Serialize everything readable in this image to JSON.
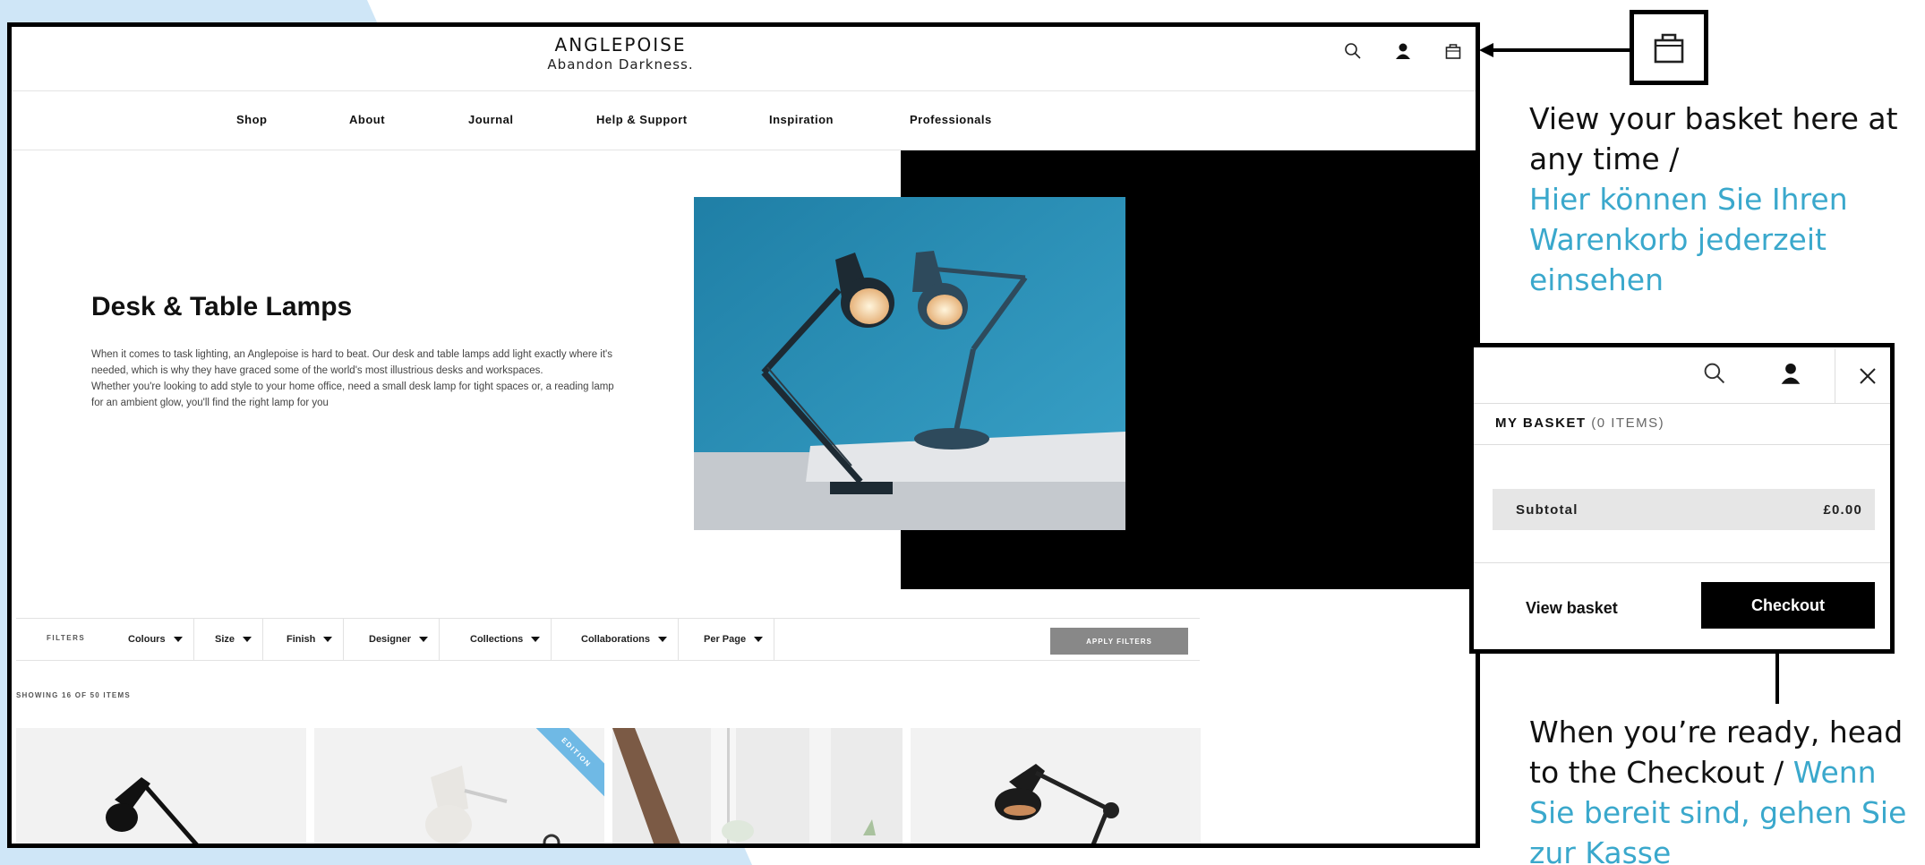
{
  "site": {
    "brand_name": "ANGLEPOISE",
    "brand_tagline": "Abandon Darkness.",
    "header_icons": [
      "search-icon",
      "account-icon",
      "basket-icon"
    ],
    "nav": [
      "Shop",
      "About",
      "Journal",
      "Help & Support",
      "Inspiration",
      "Professionals"
    ],
    "hero": {
      "title": "Desk & Table Lamps",
      "paragraph_1": "When it comes to task lighting, an Anglepoise is hard to beat. Our desk and table lamps add light exactly where it's needed, which is why they have graced some of the world's most illustrious desks and workspaces.",
      "paragraph_2": "Whether you're looking to add style to your home office, need a small desk lamp for tight spaces or, a reading lamp for an ambient glow, you'll find the right lamp for you"
    },
    "filters": {
      "label": "FILTERS",
      "items": [
        "Colours",
        "Size",
        "Finish",
        "Designer",
        "Collections",
        "Collaborations",
        "Per Page"
      ],
      "apply_label": "APPLY FILTERS"
    },
    "showing": {
      "prefix": "SHOWING",
      "shown": "16",
      "middle": "OF",
      "total": "50",
      "suffix": "ITEMS"
    },
    "product_badge": "EDITION"
  },
  "annotations": {
    "basket_en": "View your basket here at any time /",
    "basket_de": "Hier können Sie Ihren Warenkorb jederzeit einsehen",
    "checkout_en": "When you’re ready, head to the Checkout /",
    "checkout_de": "Wenn Sie bereit sind, gehen Sie zur Kasse"
  },
  "basket_panel": {
    "title": "MY BASKET",
    "count": "(0 ITEMS)",
    "subtotal_label": "Subtotal",
    "subtotal_value": "£0.00",
    "view_basket": "View basket",
    "checkout": "Checkout"
  },
  "colors": {
    "german_text": "#3aa8cc",
    "background_blob": "#cfe6f7",
    "hero_teal": "#2a8fb3",
    "checkout_button": "#000000",
    "apply_button": "#888888",
    "edition_ribbon": "#6fb9e5"
  }
}
